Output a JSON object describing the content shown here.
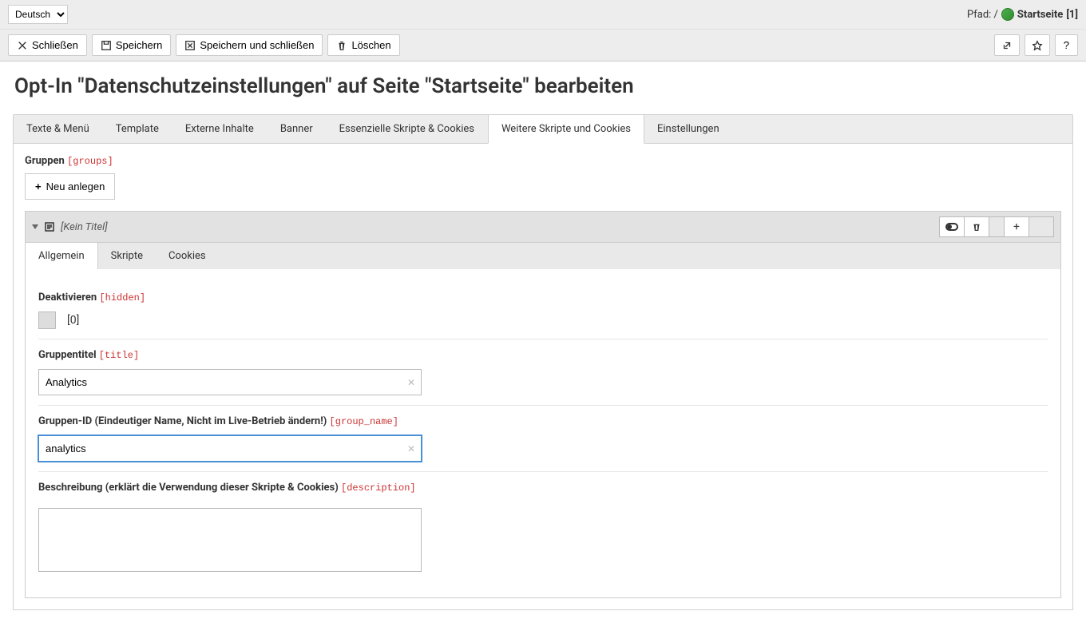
{
  "topbar": {
    "language": "Deutsch",
    "path_label": "Pfad: /",
    "page_name": "Startseite",
    "page_id": "[1]"
  },
  "toolbar": {
    "close": "Schließen",
    "save": "Speichern",
    "save_close": "Speichern und schließen",
    "delete": "Löschen"
  },
  "page_title": "Opt-In \"Datenschutzeinstellungen\" auf Seite \"Startseite\" bearbeiten",
  "tabs": {
    "t0": "Texte & Menü",
    "t1": "Template",
    "t2": "Externe Inhalte",
    "t3": "Banner",
    "t4": "Essenzielle Skripte & Cookies",
    "t5": "Weitere Skripte und Cookies",
    "t6": "Einstellungen"
  },
  "groups": {
    "label": "Gruppen",
    "hint": "[groups]",
    "new_btn": "Neu anlegen"
  },
  "record": {
    "title": "[Kein Titel]",
    "subtabs": {
      "s0": "Allgemein",
      "s1": "Skripte",
      "s2": "Cookies"
    },
    "deactivate": {
      "label": "Deaktivieren",
      "hint": "[hidden]",
      "value": "[0]"
    },
    "group_title": {
      "label": "Gruppentitel",
      "hint": "[title]",
      "value": "Analytics"
    },
    "group_id": {
      "label": "Gruppen-ID (Eindeutiger Name, Nicht im Live-Betrieb ändern!)",
      "hint": "[group_name]",
      "value": "analytics"
    },
    "description": {
      "label": "Beschreibung (erklärt die Verwendung dieser Skripte & Cookies)",
      "hint": "[description]",
      "value": ""
    }
  }
}
